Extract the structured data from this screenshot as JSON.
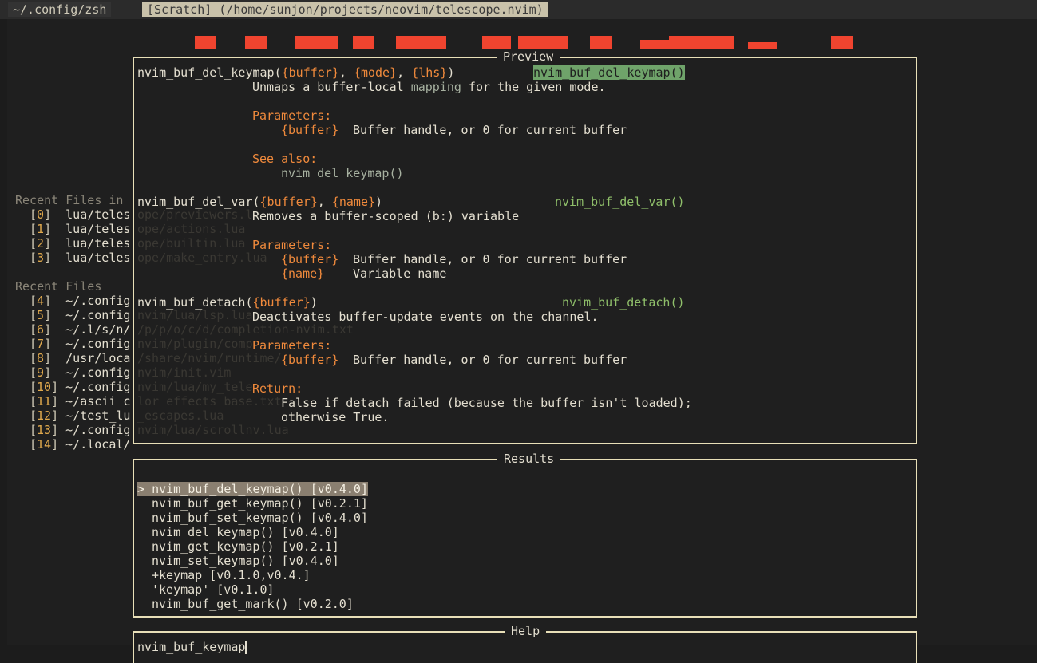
{
  "tabs": [
    {
      "label": " ~/.config/zsh ",
      "active": false
    },
    {
      "label": "[Scratch] (/home/sunjon/projects/neovim/telescope.nvim)",
      "active": true
    }
  ],
  "startify": {
    "section1_title": "Recent Files in",
    "section1_items": [
      {
        "index": "0",
        "path": "lua/teles",
        "rest": "ope/previewers.lua"
      },
      {
        "index": "1",
        "path": "lua/teles",
        "rest": "ope/actions.lua"
      },
      {
        "index": "2",
        "path": "lua/teles",
        "rest": "ope/builtin.lua"
      },
      {
        "index": "3",
        "path": "lua/teles",
        "rest": "ope/make_entry.lua"
      }
    ],
    "section2_title": "Recent Files",
    "section2_items": [
      {
        "index": "4",
        "path": "~/.config",
        "rest": ""
      },
      {
        "index": "5",
        "path": "~/.config",
        "rest": "nvim/lua/lsp.lua"
      },
      {
        "index": "6",
        "path": "~/.l/s/n/",
        "rest": "/p/p/o/c/d/completion-nvim.txt"
      },
      {
        "index": "7",
        "path": "~/.config",
        "rest": "nvim/plugin/comp"
      },
      {
        "index": "8",
        "path": "/usr/loca",
        "rest": "/share/nvim/runtime/"
      },
      {
        "index": "9",
        "path": "~/.config",
        "rest": "nvim/init.vim"
      },
      {
        "index": "10",
        "path": "~/.config",
        "rest": "nvim/lua/my_tele"
      },
      {
        "index": "11",
        "path": "~/ascii_c",
        "rest": "lor_effects_base.txt"
      },
      {
        "index": "12",
        "path": "~/test_lu",
        "rest": "_escapes.lua"
      },
      {
        "index": "13",
        "path": "~/.config",
        "rest": "nvim/lua/scrollnv.lua"
      },
      {
        "index": "14",
        "path": "~/.local/",
        "rest": ""
      }
    ]
  },
  "preview": {
    "title": "Preview",
    "entries": [
      {
        "name": "nvim_buf_del_keymap(",
        "params": [
          "{buffer}",
          "{mode}",
          "{lhs}"
        ],
        "close": ")",
        "tag": "nvim_buf_del_keymap()",
        "tag_highlighted": true,
        "desc_prefix": "Unmaps a buffer-local ",
        "desc_link": "mapping",
        "desc_suffix": " for the given mode.",
        "parameters_label": "Parameters:",
        "parameters": [
          {
            "name": "{buffer}",
            "desc": "Buffer handle, or 0 for current buffer"
          }
        ],
        "see_also_label": "See also:",
        "see_also": "nvim_del_keymap()"
      },
      {
        "name": "nvim_buf_del_var(",
        "params": [
          "{buffer}",
          "{name}"
        ],
        "close": ")",
        "tag": "nvim_buf_del_var()",
        "tag_highlighted": false,
        "desc": "Removes a buffer-scoped (b:) variable",
        "parameters_label": "Parameters:",
        "parameters": [
          {
            "name": "{buffer}",
            "desc": "Buffer handle, or 0 for current buffer"
          },
          {
            "name": "{name}",
            "desc": "Variable name"
          }
        ]
      },
      {
        "name": "nvim_buf_detach(",
        "params": [
          "{buffer}"
        ],
        "close": ")",
        "tag": "nvim_buf_detach()",
        "tag_highlighted": false,
        "desc": "Deactivates buffer-update events on the channel.",
        "parameters_label": "Parameters:",
        "parameters": [
          {
            "name": "{buffer}",
            "desc": "Buffer handle, or 0 for current buffer"
          }
        ],
        "return_label": "Return:",
        "return_lines": [
          "False if detach failed (because the buffer isn't loaded);",
          "otherwise True."
        ]
      }
    ]
  },
  "results": {
    "title": "Results",
    "prompt_marker": ">",
    "selected_index": 0,
    "items": [
      "nvim_buf_del_keymap() [v0.4.0]",
      "nvim_buf_get_keymap() [v0.2.1]",
      "nvim_buf_set_keymap() [v0.4.0]",
      "nvim_del_keymap() [v0.4.0]",
      "nvim_get_keymap() [v0.2.1]",
      "nvim_set_keymap() [v0.4.0]",
      "+keymap [v0.1.0,v0.4.]",
      "'keymap' [v0.1.0]",
      "nvim_buf_get_mark() [v0.2.0]"
    ]
  },
  "help": {
    "title": "Help",
    "query": "nvim_buf_keymap"
  },
  "colors": {
    "accent_orange": "#f08a3c",
    "tag_green": "#8fbf6a",
    "border": "#e8dfb8",
    "banner_red": "#f0442f",
    "index_yellow": "#e0a94d"
  }
}
